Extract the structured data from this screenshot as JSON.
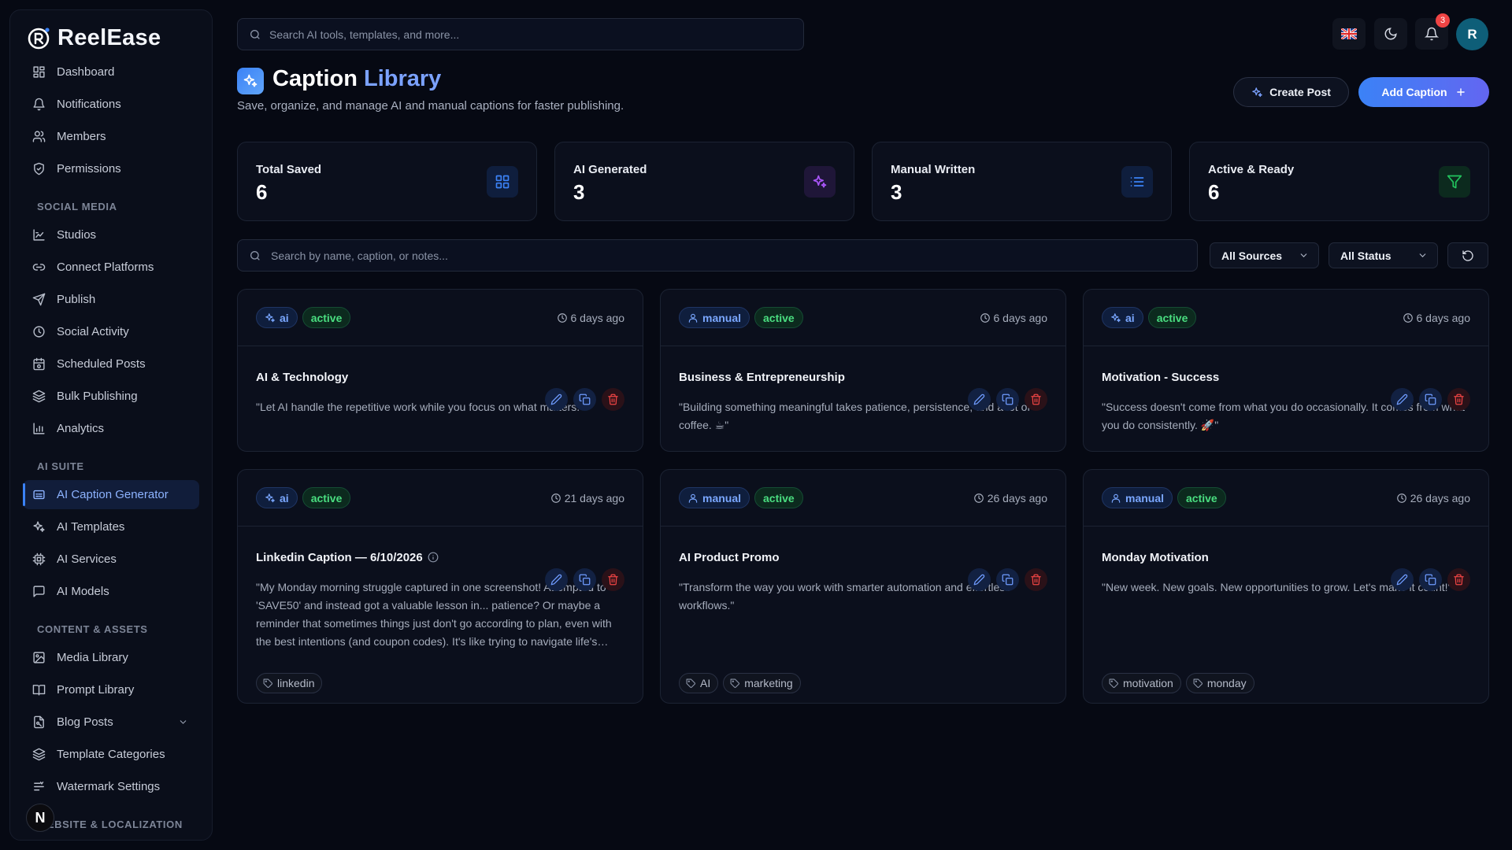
{
  "app": {
    "name": "ReelEase"
  },
  "sidebar": {
    "top_items": [
      {
        "label": "Dashboard",
        "icon": "dashboard-icon"
      },
      {
        "label": "Notifications",
        "icon": "bell-icon"
      },
      {
        "label": "Members",
        "icon": "users-icon"
      },
      {
        "label": "Permissions",
        "icon": "shield-icon"
      }
    ],
    "sections": [
      {
        "title": "SOCIAL MEDIA",
        "items": [
          {
            "label": "Studios",
            "icon": "studio-icon"
          },
          {
            "label": "Connect Platforms",
            "icon": "link-icon"
          },
          {
            "label": "Publish",
            "icon": "send-icon"
          },
          {
            "label": "Social Activity",
            "icon": "clock-icon"
          },
          {
            "label": "Scheduled Posts",
            "icon": "calendar-icon"
          },
          {
            "label": "Bulk Publishing",
            "icon": "layers-icon"
          },
          {
            "label": "Analytics",
            "icon": "bar-chart-icon"
          }
        ]
      },
      {
        "title": "AI SUITE",
        "items": [
          {
            "label": "AI Caption Generator",
            "icon": "caption-icon",
            "active": true
          },
          {
            "label": "AI Templates",
            "icon": "sparkles-icon"
          },
          {
            "label": "AI Services",
            "icon": "cpu-icon"
          },
          {
            "label": "AI Models",
            "icon": "message-square-icon"
          }
        ]
      },
      {
        "title": "CONTENT & ASSETS",
        "items": [
          {
            "label": "Media Library",
            "icon": "image-icon"
          },
          {
            "label": "Prompt Library",
            "icon": "book-icon"
          },
          {
            "label": "Blog Posts",
            "icon": "file-icon",
            "expandable": true
          },
          {
            "label": "Template Categories",
            "icon": "layers-icon"
          },
          {
            "label": "Watermark Settings",
            "icon": "watermark-icon"
          }
        ]
      },
      {
        "title": "WEBSITE & LOCALIZATION",
        "items": []
      }
    ],
    "footer_badge": "N"
  },
  "topbar": {
    "search_placeholder": "Search AI tools, templates, and more...",
    "notification_count": "3",
    "avatar_initial": "R"
  },
  "page": {
    "title_main": "Caption",
    "title_accent": "Library",
    "subtitle": "Save, organize, and manage AI and manual captions for faster publishing.",
    "create_post_label": "Create Post",
    "add_caption_label": "Add Caption"
  },
  "stats": [
    {
      "label": "Total Saved",
      "value": "6",
      "icon": "grid-icon",
      "color": "#3b82f6",
      "bg": "#0f1e3d"
    },
    {
      "label": "AI Generated",
      "value": "3",
      "icon": "sparkles-icon",
      "color": "#a855f7",
      "bg": "#1f1638"
    },
    {
      "label": "Manual Written",
      "value": "3",
      "icon": "list-icon",
      "color": "#3b82f6",
      "bg": "#0f1e3d"
    },
    {
      "label": "Active & Ready",
      "value": "6",
      "icon": "filter-icon",
      "color": "#22c55e",
      "bg": "#0c2a1e"
    }
  ],
  "filters": {
    "search_placeholder": "Search by name, caption, or notes...",
    "source": "All Sources",
    "status": "All Status"
  },
  "cards": [
    {
      "source": "ai",
      "status": "active",
      "time": "6 days ago",
      "title": "AI & Technology",
      "caption": "\"Let AI handle the repetitive work while you focus on what matters.\"",
      "tags": []
    },
    {
      "source": "manual",
      "status": "active",
      "time": "6 days ago",
      "title": "Business & Entrepreneurship",
      "caption": "\"Building something meaningful takes patience, persistence, and a lot of coffee. ☕\"",
      "tags": []
    },
    {
      "source": "ai",
      "status": "active",
      "time": "6 days ago",
      "title": "Motivation - Success",
      "caption": "\"Success doesn't come from what you do occasionally. It comes from what you do consistently. 🚀\"",
      "tags": []
    },
    {
      "source": "ai",
      "status": "active",
      "time": "21 days ago",
      "title": "Linkedin Caption — 6/10/2026",
      "info": true,
      "caption": "\"My Monday morning struggle captured in one screenshot! Attempted to 'SAVE50' and instead got a valuable lesson in... patience? Or maybe a reminder that sometimes things just don't go according to plan, even with the best intentions (and coupon codes). It's like trying to navigate life's unexpected twists and turns.\"",
      "tags": [
        "linkedin"
      ]
    },
    {
      "source": "manual",
      "status": "active",
      "time": "26 days ago",
      "title": "AI Product Promo",
      "caption": "\"Transform the way you work with smarter automation and effortless workflows.\"",
      "tags": [
        "AI",
        "marketing"
      ]
    },
    {
      "source": "manual",
      "status": "active",
      "time": "26 days ago",
      "title": "Monday Motivation",
      "caption": "\"New week. New goals. New opportunities to grow. Let's make it count!\"",
      "tags": [
        "motivation",
        "monday"
      ]
    }
  ]
}
